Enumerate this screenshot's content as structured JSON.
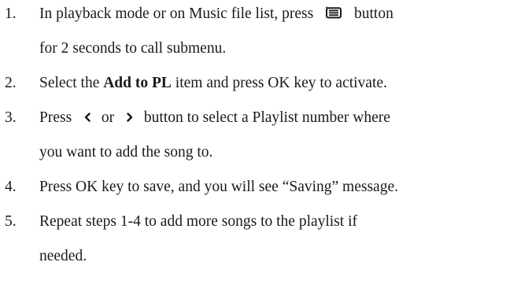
{
  "steps": [
    {
      "number": "1.",
      "text_before_icon": "In playback mode or on Music file list, press",
      "icon": "menu-icon",
      "text_after_icon": "button",
      "continuation": "for 2 seconds to call submenu."
    },
    {
      "number": "2.",
      "text_before_bold": "Select the",
      "bold": "Add to PL",
      "text_after_bold": "item and press OK key to activate."
    },
    {
      "number": "3.",
      "text_before_icon": "Press",
      "icon_left": "chevron-left-icon",
      "middle": "or",
      "icon_right": "chevron-right-icon",
      "text_after_icon": "button to select a Playlist number where",
      "continuation": "you want to add the song to."
    },
    {
      "number": "4.",
      "text": "Press OK key to save, and you will see “Saving” message."
    },
    {
      "number": "5.",
      "text": "Repeat steps 1-4 to add more songs to the playlist if",
      "continuation": "needed."
    }
  ]
}
